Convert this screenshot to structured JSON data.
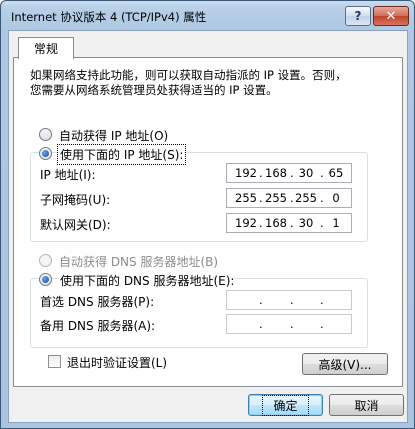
{
  "window": {
    "title": "Internet 协议版本 4 (TCP/IPv4) 属性",
    "help_label": "?",
    "close_label": "✕"
  },
  "tabs": [
    {
      "label": "常规"
    }
  ],
  "description": {
    "line1": "如果网络支持此功能，则可以获取自动指派的 IP 设置。否则，",
    "line2": "您需要从网络系统管理员处获得适当的 IP 设置。"
  },
  "ip_section": {
    "auto_radio": "自动获得 IP 地址(O)",
    "manual_radio": "使用下面的 IP 地址(S):",
    "selected": "manual",
    "fields": [
      {
        "label": "IP 地址(I):",
        "octets": [
          "192",
          "168",
          "30",
          "65"
        ]
      },
      {
        "label": "子网掩码(U):",
        "octets": [
          "255",
          "255",
          "255",
          "0"
        ]
      },
      {
        "label": "默认网关(D):",
        "octets": [
          "192",
          "168",
          "30",
          "1"
        ]
      }
    ]
  },
  "dns_section": {
    "auto_radio": "自动获得 DNS 服务器地址(B)",
    "manual_radio": "使用下面的 DNS 服务器地址(E):",
    "selected": "manual",
    "fields": [
      {
        "label": "首选 DNS 服务器(P):",
        "octets": [
          "",
          "",
          "",
          ""
        ]
      },
      {
        "label": "备用 DNS 服务器(A):",
        "octets": [
          "",
          "",
          "",
          ""
        ]
      }
    ]
  },
  "validate_on_exit": {
    "label": "退出时验证设置(L)",
    "checked": false
  },
  "buttons": {
    "advanced": "高级(V)...",
    "ok": "确定",
    "cancel": "取消"
  },
  "colors": {
    "title_gradient_top": "#c9dcef",
    "title_gradient_bottom": "#aac4df",
    "panel_bg": "#ffffff",
    "dialog_bg": "#f0f0f0",
    "close_button": "#c0432c",
    "default_button_border": "#3c7fb1"
  }
}
